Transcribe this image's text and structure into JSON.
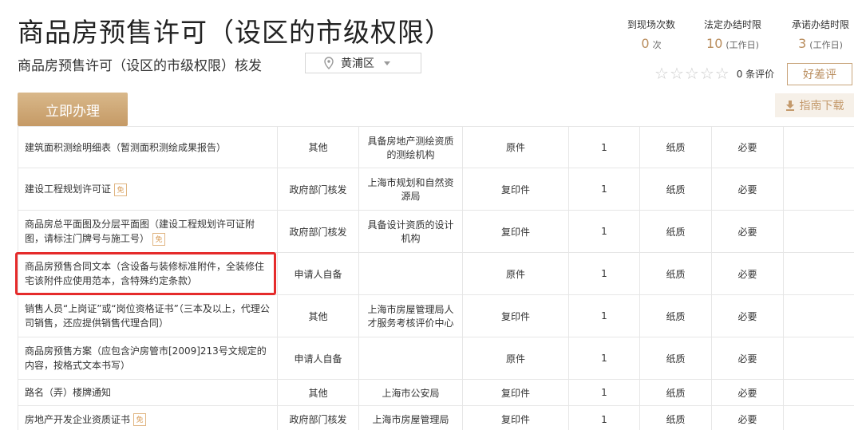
{
  "header": {
    "title": "商品房预售许可（设区的市级权限）",
    "subtitle": "商品房预售许可（设区的市级权限）核发",
    "region": "黄浦区"
  },
  "stats": [
    {
      "label": "到现场次数",
      "value": "0",
      "unit": "次"
    },
    {
      "label": "法定办结时限",
      "value": "10",
      "unit": "(工作日)"
    },
    {
      "label": "承诺办结时限",
      "value": "3",
      "unit": "(工作日)"
    }
  ],
  "rating": {
    "stars": 0,
    "max": 5,
    "count_text": "0 条评价",
    "button": "好差评"
  },
  "buttons": {
    "apply": "立即办理",
    "guide": "指南下载"
  },
  "badge_text": "免",
  "table": {
    "rows": [
      {
        "name": "建筑面积测绘明细表（暂测面积测绘成果报告）",
        "badge": false,
        "source": "其他",
        "issuer": "具备房地产测绘资质的测绘机构",
        "form": "原件",
        "copies": "1",
        "medium": "纸质",
        "required": "必要"
      },
      {
        "name": "建设工程规划许可证",
        "badge": true,
        "source": "政府部门核发",
        "issuer": "上海市规划和自然资源局",
        "form": "复印件",
        "copies": "1",
        "medium": "纸质",
        "required": "必要"
      },
      {
        "name": "商品房总平面图及分层平面图（建设工程规划许可证附图，请标注门牌号与施工号）",
        "badge": true,
        "source": "政府部门核发",
        "issuer": "具备设计资质的设计机构",
        "form": "复印件",
        "copies": "1",
        "medium": "纸质",
        "required": "必要"
      },
      {
        "name": "商品房预售合同文本（含设备与装修标准附件，全装修住宅该附件应使用范本，含特殊约定条款）",
        "badge": false,
        "source": "申请人自备",
        "issuer": "",
        "form": "原件",
        "copies": "1",
        "medium": "纸质",
        "required": "必要"
      },
      {
        "name": "销售人员“上岗证”或“岗位资格证书”（三本及以上，代理公司销售，还应提供销售代理合同）",
        "badge": false,
        "source": "其他",
        "issuer": "上海市房屋管理局人才服务考核评价中心",
        "form": "复印件",
        "copies": "1",
        "medium": "纸质",
        "required": "必要"
      },
      {
        "name": "商品房预售方案（应包含沪房管市[2009]213号文规定的内容，按格式文本书写）",
        "badge": false,
        "source": "申请人自备",
        "issuer": "",
        "form": "原件",
        "copies": "1",
        "medium": "纸质",
        "required": "必要"
      },
      {
        "name": "路名（弄）楼牌通知",
        "badge": false,
        "source": "其他",
        "issuer": "上海市公安局",
        "form": "复印件",
        "copies": "1",
        "medium": "纸质",
        "required": "必要"
      },
      {
        "name": "房地产开发企业资质证书",
        "badge": true,
        "source": "政府部门核发",
        "issuer": "上海市房屋管理局",
        "form": "复印件",
        "copies": "1",
        "medium": "纸质",
        "required": "必要"
      }
    ]
  }
}
